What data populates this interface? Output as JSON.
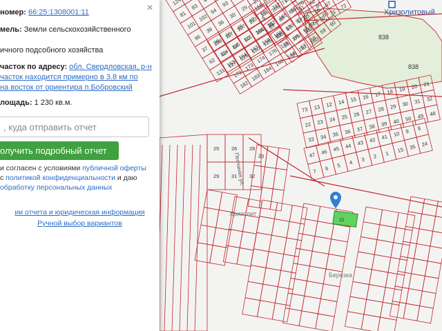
{
  "panel": {
    "number_label": "номер:",
    "number_value": "66:25:1308001:11",
    "category_label": "мель:",
    "category_value": "Земли сельскохозяйственного",
    "use_value": "ичного подсобного хозяйства",
    "address_label": "часток по адресу:",
    "address_line1": "обл. Свердловская, р-н",
    "address_line2": "часток находится примерно в 3.8 км по",
    "address_line3": "на восток от ориентира п.Бобровский",
    "area_label": "лощадь:",
    "area_value": "1 230 кв.м.",
    "email_placeholder": ", куда отправить отчет",
    "order_button": "олучить подробный отчет",
    "consent_line1_a": "и согласен с условиями ",
    "consent_line1_link": "публичной оферты",
    "consent_line2_a": "с ",
    "consent_line2_link": "политикой конфиденциальности",
    "consent_line2_b": " и даю",
    "consent_line3_link": "обработку персональных данных",
    "report_info_link": "ии отчета и юридическая информация",
    "manual_choice_link": "Ручной выбор вариантов",
    "close_icon": "×"
  },
  "map": {
    "place_label_top": "Хризолитовый",
    "area_label_838_a": "838",
    "area_label_838_b": "838",
    "street_label": "Песчаная ул.",
    "village_label": "Хризолит",
    "street_label_2": "Березка",
    "selected_parcel": "11",
    "lot_numbers": [
      "124",
      "90",
      "106",
      "104",
      "104",
      "259",
      "81",
      "83",
      "4",
      "99",
      "95",
      "100",
      "101",
      "102",
      "94",
      "93",
      "92",
      "97",
      "96",
      "38",
      "36",
      "30",
      "29",
      "27",
      "37",
      "36",
      "46",
      "45",
      "47",
      "61",
      "62",
      "63",
      "64",
      "60",
      "106",
      "91",
      "131",
      "127",
      "126",
      "130",
      "125",
      "105",
      "128",
      "117",
      "107",
      "110",
      "111",
      "112",
      "113",
      "114",
      "115",
      "116",
      "161",
      "162",
      "165",
      "166",
      "163",
      "164",
      "167",
      "168",
      "169",
      "170",
      "171",
      "172",
      "173",
      "174",
      "176",
      "178",
      "179",
      "180",
      "182",
      "183",
      "184",
      "140",
      "144",
      "162",
      "160",
      "158",
      "154",
      "176",
      "5",
      "205",
      "6",
      "205",
      "71",
      "72",
      "69",
      "89",
      "88",
      "85",
      "76",
      "78",
      "81",
      "93",
      "82",
      "79",
      "80",
      "83",
      "84",
      "86",
      "54",
      "55",
      "56",
      "57",
      "58",
      "59",
      "60",
      "61",
      "62",
      "63",
      "64",
      "65",
      "66",
      "67",
      "68",
      "69",
      "70",
      "71",
      "72",
      "73",
      "13",
      "12",
      "14",
      "15",
      "16",
      "17",
      "18",
      "19",
      "20",
      "21",
      "22",
      "23",
      "24",
      "25",
      "26",
      "27",
      "28",
      "29",
      "30",
      "31",
      "32",
      "33",
      "34",
      "35",
      "36",
      "37",
      "38",
      "39",
      "40",
      "50",
      "49",
      "48",
      "47",
      "46",
      "45",
      "44",
      "43",
      "42",
      "41",
      "10",
      "9",
      "8",
      "7",
      "6",
      "5",
      "4",
      "3",
      "2",
      "1",
      "15",
      "35",
      "24",
      "25",
      "26",
      "28",
      "29",
      "31",
      "32",
      "33"
    ],
    "colors": {
      "lot_line": "#c0272d",
      "forest": "#e3eedb",
      "background": "#f3f4f2",
      "selected": "#5fd35f",
      "pin": "#2f7fd6"
    }
  }
}
